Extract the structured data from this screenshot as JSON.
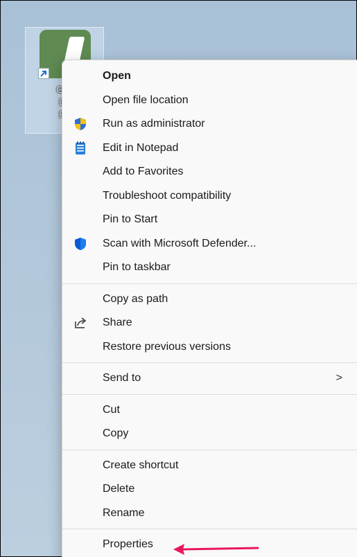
{
  "desktop": {
    "shortcut": {
      "label_lines": [
        "Golf",
        "Dri",
        "Ra"
      ]
    }
  },
  "context_menu": {
    "groups": [
      [
        {
          "label": "Open",
          "bold": true,
          "icon": null
        },
        {
          "label": "Open file location",
          "icon": null
        },
        {
          "label": "Run as administrator",
          "icon": "uac-shield-icon"
        },
        {
          "label": "Edit in Notepad",
          "icon": "notepad-icon"
        },
        {
          "label": "Add to Favorites",
          "icon": null
        },
        {
          "label": "Troubleshoot compatibility",
          "icon": null
        },
        {
          "label": "Pin to Start",
          "icon": null
        },
        {
          "label": "Scan with Microsoft Defender...",
          "icon": "defender-shield-icon"
        },
        {
          "label": "Pin to taskbar",
          "icon": null
        }
      ],
      [
        {
          "label": "Copy as path",
          "icon": null
        },
        {
          "label": "Share",
          "icon": "share-icon"
        },
        {
          "label": "Restore previous versions",
          "icon": null
        }
      ],
      [
        {
          "label": "Send to",
          "icon": null,
          "submenu": true,
          "chevron": ">"
        }
      ],
      [
        {
          "label": "Cut",
          "icon": null
        },
        {
          "label": "Copy",
          "icon": null
        }
      ],
      [
        {
          "label": "Create shortcut",
          "icon": null
        },
        {
          "label": "Delete",
          "icon": null
        },
        {
          "label": "Rename",
          "icon": null
        }
      ],
      [
        {
          "label": "Properties",
          "icon": null
        }
      ]
    ]
  },
  "annotation": {
    "arrow_color": "#e8175d",
    "points_to": "Properties"
  },
  "colors": {
    "menu_bg": "#f9f9f9",
    "desktop_bg": "#b5c9dc",
    "app_icon_green": "#5f8a52"
  }
}
